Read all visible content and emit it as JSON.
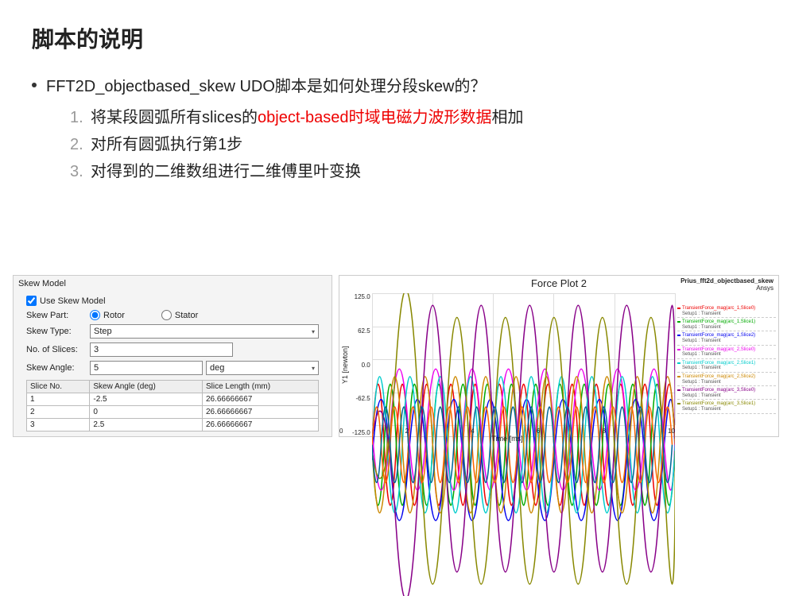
{
  "title": "脚本的说明",
  "bullet": "FFT2D_objectbased_skew UDO脚本是如何处理分段skew的？",
  "steps": {
    "n1": "1.",
    "s1a": "将某段圆弧所有slices的",
    "s1b": "object-based",
    "s1c": "时域电磁力波形数据",
    "s1d": "相加",
    "n2": "2.",
    "s2": "对所有圆弧执行第1步",
    "n3": "3.",
    "s3": "对得到的二维数组进行二维傅里叶变换"
  },
  "skew": {
    "header": "Skew Model",
    "use_label": "Use Skew Model",
    "part_label": "Skew Part:",
    "rotor": "Rotor",
    "stator": "Stator",
    "type_label": "Skew Type:",
    "type_value": "Step",
    "slices_label": "No. of Slices:",
    "slices_value": "3",
    "angle_label": "Skew Angle:",
    "angle_value": "5",
    "angle_unit": "deg",
    "col1": "Slice No.",
    "col2": "Skew Angle (deg)",
    "col3": "Slice Length (mm)",
    "r1c1": "1",
    "r1c2": "-2.5",
    "r1c3": "26.66666667",
    "r2c1": "2",
    "r2c2": "0",
    "r2c3": "26.66666667",
    "r3c1": "3",
    "r3c2": "2.5",
    "r3c3": "26.66666667"
  },
  "plot": {
    "title": "Force Plot 2",
    "subtitle": "Prius_fft2d_objectbased_skew",
    "brand": "Ansys",
    "xlabel": "Time [ms]",
    "ylabel": "Y1 [newton]",
    "yticks": {
      "t0": "125.0",
      "t1": "62.5",
      "t2": "0.0",
      "t3": "-62.5",
      "t4": "-125.0"
    },
    "xticks": {
      "x0": "0",
      "x1": "2",
      "x2": "4",
      "x3": "6",
      "x4": "8",
      "x5": "10"
    },
    "legend_sub": "Setup1 : Transient",
    "legend": {
      "l0": "TransientForce_mag(arc_1,Slice0)",
      "l1": "TransientForce_mag(arc_1,Slice1)",
      "l2": "TransientForce_mag(arc_1,Slice2)",
      "l3": "TransientForce_mag(arc_2,Slice0)",
      "l4": "TransientForce_mag(arc_2,Slice1)",
      "l5": "TransientForce_mag(arc_2,Slice2)",
      "l6": "TransientForce_mag(arc_3,Slice0)",
      "l7": "TransientForce_mag(arc_3,Slice1)"
    }
  }
}
